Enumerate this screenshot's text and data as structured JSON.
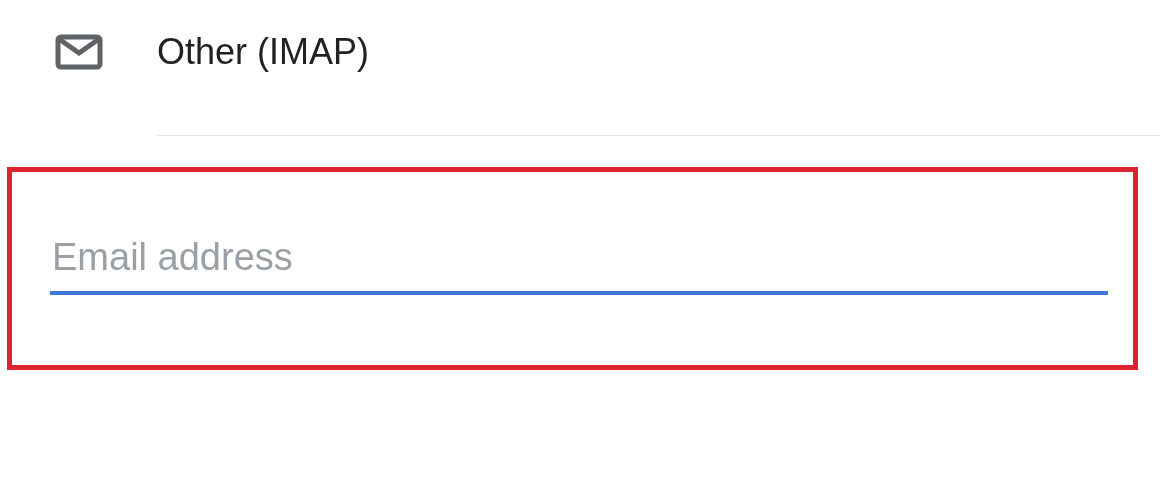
{
  "account_options": [
    {
      "label": "Other (IMAP)",
      "kind": "mail"
    }
  ],
  "email_field": {
    "placeholder": "Email address",
    "focused": true,
    "highlighted": true
  }
}
